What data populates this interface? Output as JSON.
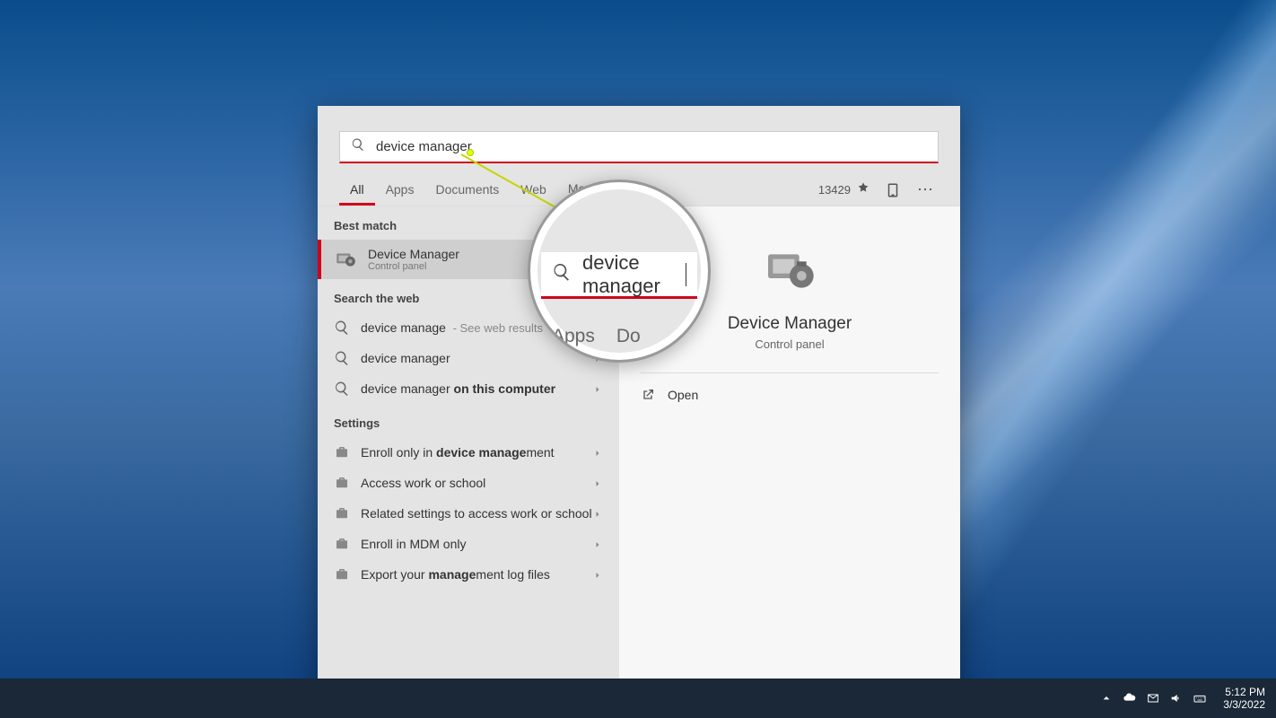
{
  "search": {
    "query": "device manager",
    "magnifier_text": "device manager",
    "magnifier_tab_apps": "Apps",
    "magnifier_tab_docs_fragment": "Do"
  },
  "tabs": {
    "all": "All",
    "apps": "Apps",
    "documents": "Documents",
    "web": "Web",
    "more": "More"
  },
  "header": {
    "points": "13429"
  },
  "sections": {
    "best_match": "Best match",
    "search_web": "Search the web",
    "settings": "Settings"
  },
  "best_match": {
    "title": "Device Manager",
    "subtitle": "Control panel"
  },
  "web_results": [
    {
      "prefix": "device manage",
      "bold": "",
      "hint": " - See web results"
    },
    {
      "prefix": "device manager",
      "bold": "",
      "hint": ""
    },
    {
      "prefix": "device manager",
      "bold": " on this computer",
      "hint": ""
    }
  ],
  "settings_results": [
    {
      "pre": "Enroll only in ",
      "bold": "device manage",
      "post": "ment"
    },
    {
      "pre": "Access work or school",
      "bold": "",
      "post": ""
    },
    {
      "pre": "Related settings to access work or school",
      "bold": "",
      "post": ""
    },
    {
      "pre": "Enroll in MDM only",
      "bold": "",
      "post": ""
    },
    {
      "pre": "Export your ",
      "bold": "manage",
      "post": "ment log files"
    }
  ],
  "preview": {
    "title": "Device Manager",
    "subtitle": "Control panel",
    "open": "Open"
  },
  "tray": {
    "time": "5:12 PM",
    "date": "3/3/2022"
  }
}
